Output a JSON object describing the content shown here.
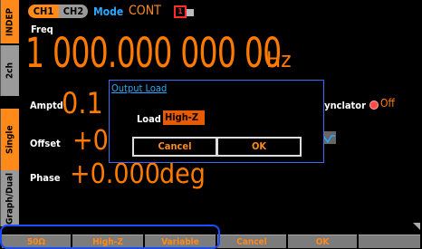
{
  "side_tabs": {
    "indep": "INDEP",
    "ch2": "2ch",
    "single": "Single",
    "graph_dual": "Graph/Dual"
  },
  "header": {
    "ch1": "CH1",
    "ch2": "CH2",
    "mode_label": "Mode",
    "mode_value": "CONT",
    "indicator": "1"
  },
  "freq": {
    "label": "Freq",
    "value": "1 000.000 000 00",
    "unit": "Hz"
  },
  "amptd": {
    "label": "Amptd",
    "value": "0.1"
  },
  "offset": {
    "label": "Offset",
    "value": "+0."
  },
  "phase": {
    "label": "Phase",
    "value": "+0.000",
    "unit": "deg"
  },
  "synclator": {
    "label": "Synclator",
    "state": "Off"
  },
  "dialog": {
    "title": "Output Load",
    "load_label": "Load",
    "load_value": "High-Z",
    "cancel": "Cancel",
    "ok": "OK"
  },
  "softkeys": [
    "50Ω",
    "High-Z",
    "Variable",
    "Cancel",
    "OK",
    ""
  ],
  "colors": {
    "accent": "#ff7a00",
    "highlight": "#1a4cff",
    "dialog_border": "#3b6bff"
  }
}
